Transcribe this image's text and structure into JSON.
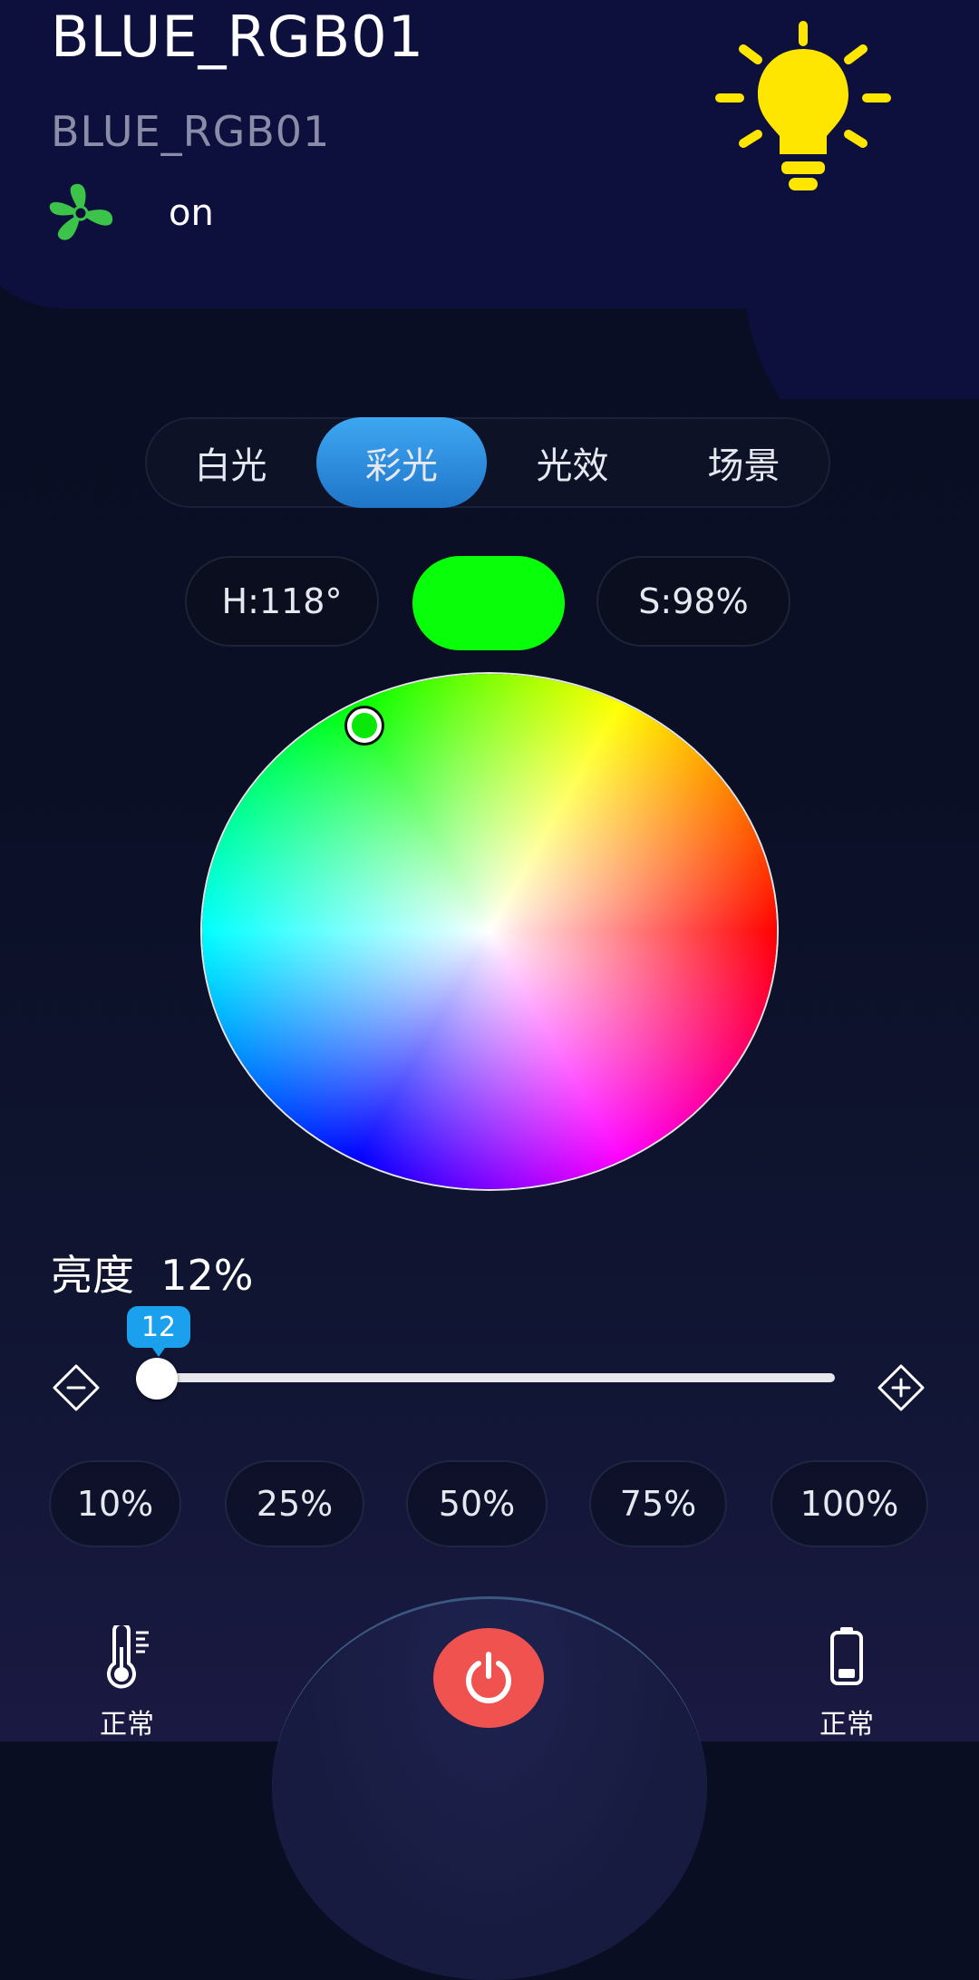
{
  "device": {
    "title": "BLUE_RGB01",
    "subtitle": "BLUE_RGB01",
    "status": "on"
  },
  "tabs": [
    {
      "label": "白光",
      "active": false
    },
    {
      "label": "彩光",
      "active": true
    },
    {
      "label": "光效",
      "active": false
    },
    {
      "label": "场景",
      "active": false
    }
  ],
  "color": {
    "hue_label": "H:118°",
    "saturation_label": "S:98%",
    "swatch_color": "#09ff09"
  },
  "brightness": {
    "label": "亮度",
    "value_label": "12%",
    "slider_value": "12",
    "level_fraction": 0.12
  },
  "presets": [
    "10%",
    "25%",
    "50%",
    "75%",
    "100%"
  ],
  "footer": {
    "temperature_status": "正常",
    "battery_status": "正常"
  },
  "colors": {
    "accent": "#1aa0ec",
    "power": "#f0534f",
    "bulb": "#ffe600",
    "fan": "#3cc44a"
  }
}
